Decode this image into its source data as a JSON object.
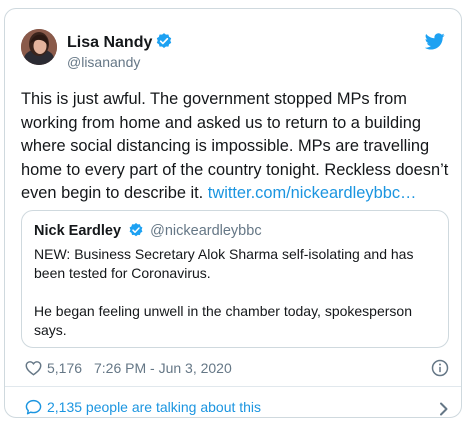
{
  "author": {
    "name": "Lisa Nandy",
    "handle": "@lisanandy"
  },
  "tweet": {
    "text": "This is just awful. The government stopped MPs from working from home and asked us to return to a building where social distancing is impossible. MPs are travelling home to every part of the country tonight. Reckless doesn’t even begin to describe it.",
    "link": "twitter.com/nickeardleybbc…"
  },
  "quoted": {
    "name": "Nick Eardley",
    "handle": "@nickeardleybbc",
    "paragraph1": "NEW: Business Secretary Alok Sharma self-isolating and has been tested for Coronavirus.",
    "paragraph2": "He began feeling unwell in the chamber today, spokesperson says."
  },
  "meta": {
    "likes": "5,176",
    "timestamp": "7:26 PM - Jun 3, 2020"
  },
  "footer": {
    "talking": "2,135 people are talking about this"
  },
  "icons": {
    "verified": "verified-badge-icon",
    "bird": "twitter-bird-icon",
    "heart": "heart-icon",
    "info": "info-icon",
    "bubble": "speech-bubble-icon",
    "chevron": "chevron-right-icon"
  },
  "colors": {
    "link": "#1b95e0",
    "secondary_text": "#657786",
    "border": "#cfd9de",
    "verified": "#1da1f2"
  }
}
